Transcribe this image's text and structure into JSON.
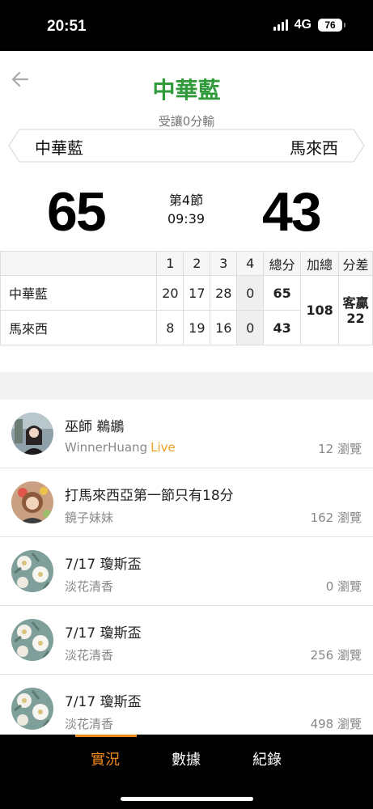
{
  "status": {
    "time": "20:51",
    "network": "4G",
    "battery": "76"
  },
  "header": {
    "title": "中華藍",
    "handicap": "受讓0分輸",
    "team_left": "中華藍",
    "team_right": "馬來西",
    "score_left": "65",
    "score_right": "43",
    "period": "第4節",
    "clock": "09:39"
  },
  "boxscore": {
    "headers": [
      "1",
      "2",
      "3",
      "4",
      "總分",
      "加總",
      "分差"
    ],
    "rows": [
      {
        "team": "中華藍",
        "q": [
          "20",
          "17",
          "28",
          "0"
        ],
        "total": "65"
      },
      {
        "team": "馬來西",
        "q": [
          "8",
          "19",
          "16",
          "0"
        ],
        "total": "43"
      }
    ],
    "sum": "108",
    "diff_label": "客贏",
    "diff_value": "22"
  },
  "posts": [
    {
      "title": "巫師 鵜鶘",
      "author": "WinnerHuang",
      "live": "Live",
      "views": "12 瀏覽"
    },
    {
      "title": "打馬來西亞第一節只有18分",
      "author": "鏡子妹妹",
      "views": "162 瀏覽"
    },
    {
      "title": "7/17 瓊斯盃",
      "author": "淡花清香",
      "views": "0 瀏覽"
    },
    {
      "title": "7/17 瓊斯盃",
      "author": "淡花清香",
      "views": "256 瀏覽"
    },
    {
      "title": "7/17 瓊斯盃",
      "author": "淡花清香",
      "views": "498 瀏覽"
    }
  ],
  "nav": {
    "tab1": "實況",
    "tab2": "數據",
    "tab3": "紀錄"
  },
  "colors": {
    "accent": "#f08a1c",
    "title_green": "#2f9a3a",
    "live": "#f0a020"
  }
}
